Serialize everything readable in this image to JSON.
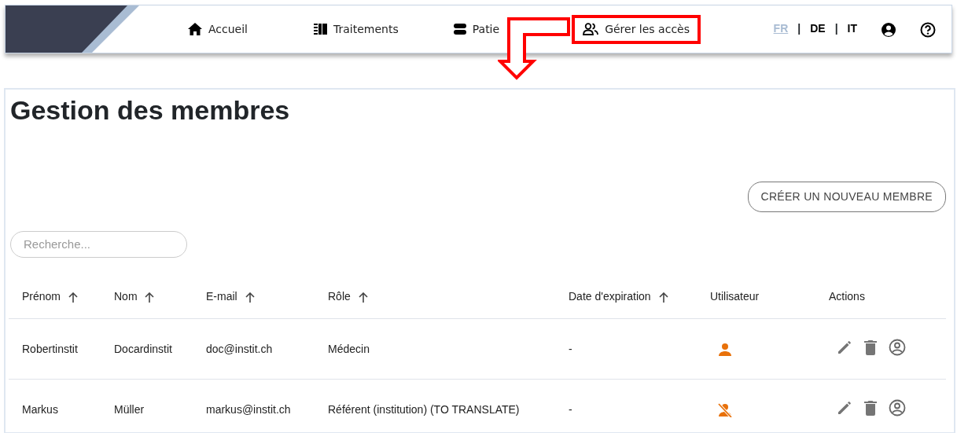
{
  "nav": {
    "items": [
      {
        "label": "Accueil",
        "highlighted": false
      },
      {
        "label": "Traitements",
        "highlighted": false
      },
      {
        "label": "Patie",
        "highlighted": false
      },
      {
        "label": "Gérer les accès",
        "highlighted": true
      }
    ],
    "languages": [
      {
        "label": "FR",
        "selected": true
      },
      {
        "label": "DE",
        "selected": false
      },
      {
        "label": "IT",
        "selected": false
      }
    ],
    "separators": [
      "|",
      "|"
    ]
  },
  "annotation": {
    "kind": "arrow"
  },
  "page": {
    "title": "Gestion des membres",
    "create_button": "CRÉER UN NOUVEAU MEMBRE",
    "search": {
      "placeholder": "Recherche..."
    }
  },
  "table": {
    "columns": [
      {
        "label": "Prénom",
        "sortable": true
      },
      {
        "label": "Nom",
        "sortable": true
      },
      {
        "label": "E-mail",
        "sortable": true
      },
      {
        "label": "Rôle",
        "sortable": true
      },
      {
        "label": "Date d'expiration",
        "sortable": true
      },
      {
        "label": "Utilisateur",
        "sortable": false
      },
      {
        "label": "Actions",
        "sortable": false
      }
    ],
    "rows": [
      {
        "first_name": "Robertinstit",
        "last_name": "Docardinstit",
        "email": "doc@instit.ch",
        "role": "Médecin",
        "expiry": "-",
        "user_active": true
      },
      {
        "first_name": "Markus",
        "last_name": "Müller",
        "email": "markus@instit.ch",
        "role": "Référent (institution) (TO TRANSLATE)",
        "expiry": "-",
        "user_active": false
      }
    ]
  }
}
